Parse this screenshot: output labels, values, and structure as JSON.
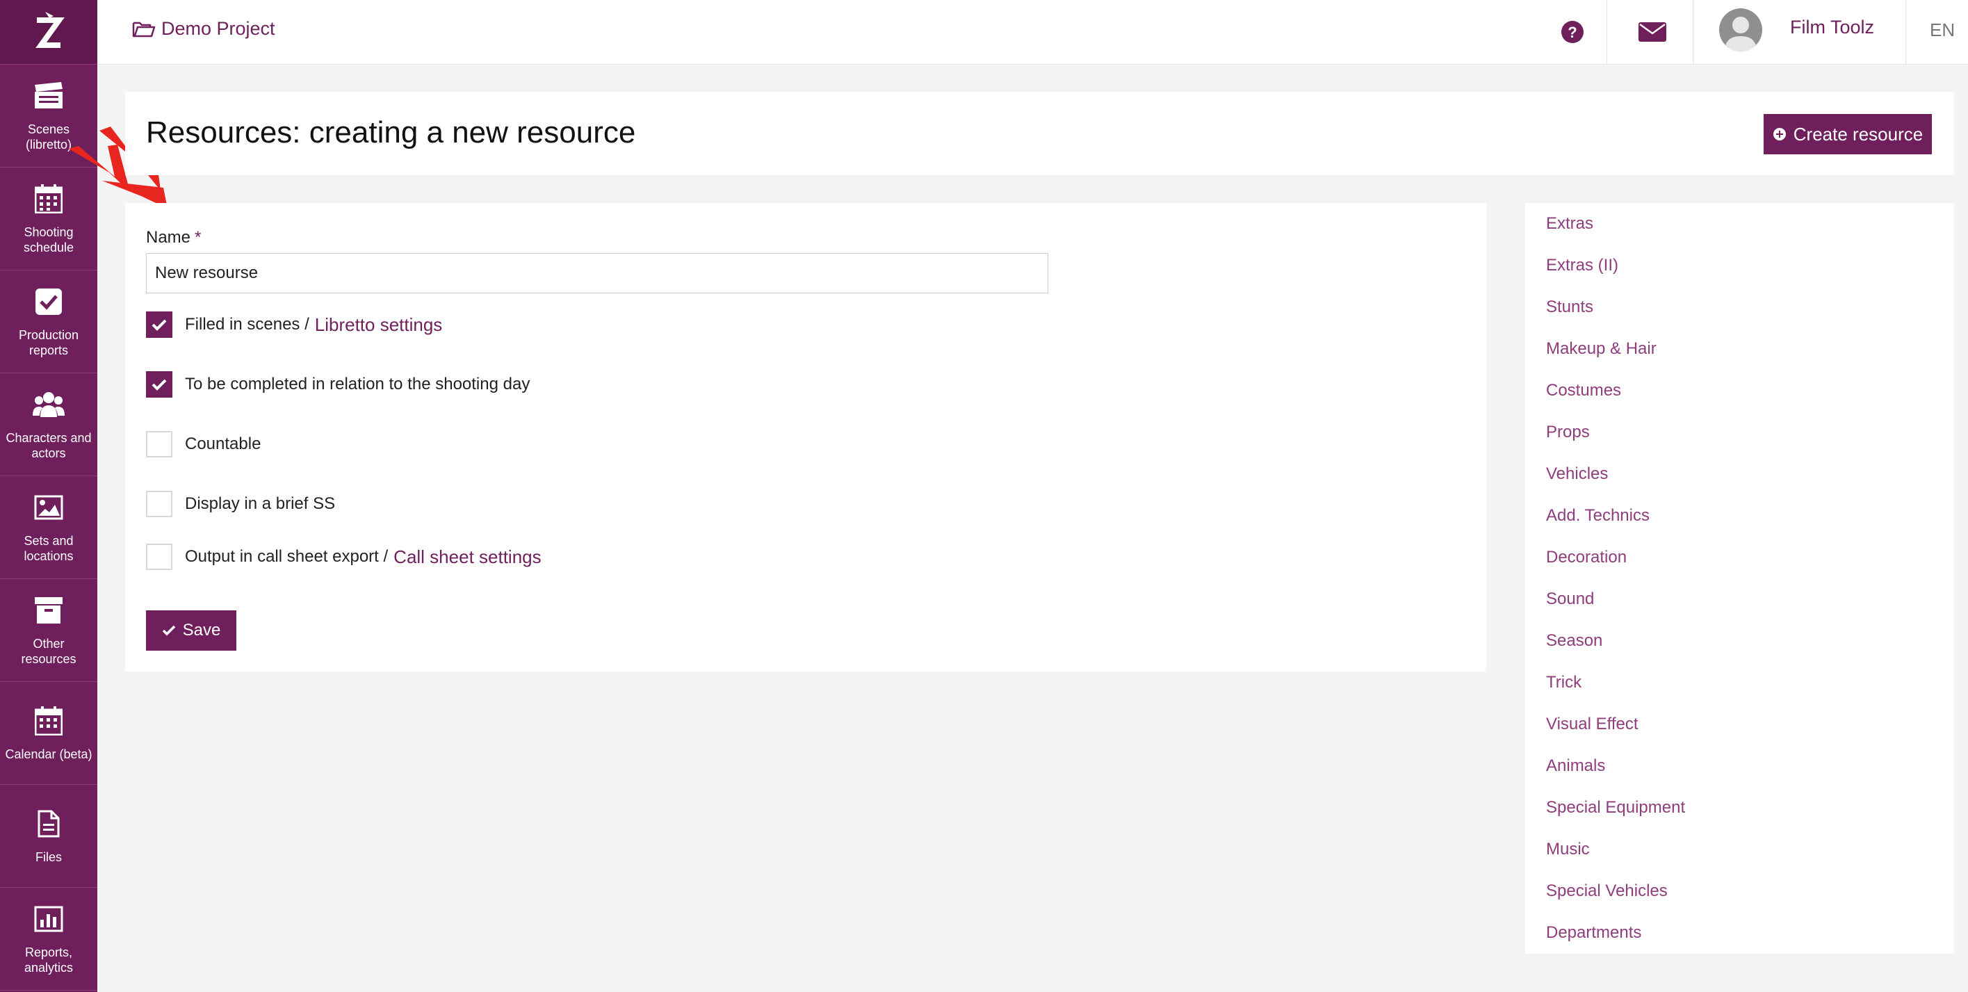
{
  "sidebar": {
    "logo": "Z",
    "items": [
      {
        "label": "Scenes (libretto)",
        "icon": "clapperboard-icon"
      },
      {
        "label": "Shooting schedule",
        "icon": "calendar-grid-icon"
      },
      {
        "label": "Production reports",
        "icon": "check-square-icon"
      },
      {
        "label": "Characters and actors",
        "icon": "users-icon"
      },
      {
        "label": "Sets and locations",
        "icon": "image-icon"
      },
      {
        "label": "Other resources",
        "icon": "archive-box-icon"
      },
      {
        "label": "Calendar (beta)",
        "icon": "calendar-icon"
      },
      {
        "label": "Files",
        "icon": "file-icon"
      },
      {
        "label": "Reports, analytics",
        "icon": "bar-chart-icon"
      }
    ]
  },
  "topbar": {
    "project": "Demo Project",
    "user": "Film Toolz",
    "language": "EN"
  },
  "header": {
    "title": "Resources: creating a new resource",
    "create_button": "Create resource"
  },
  "form": {
    "name_label": "Name",
    "required_mark": "*",
    "name_value": "New resourse",
    "checkboxes": [
      {
        "label": "Filled in scenes /",
        "link": "Libretto settings",
        "checked": true
      },
      {
        "label": "To be completed in relation to the shooting day",
        "checked": true
      },
      {
        "label": "Countable",
        "checked": false
      },
      {
        "label": "Display in a brief SS",
        "checked": false
      },
      {
        "label": "Output in call sheet export /",
        "link": "Call sheet settings",
        "checked": false
      }
    ],
    "save_button": "Save"
  },
  "resources": [
    "Extras",
    "Extras (II)",
    "Stunts",
    "Makeup & Hair",
    "Costumes",
    "Props",
    "Vehicles",
    "Add. Technics",
    "Decoration",
    "Sound",
    "Season",
    "Trick",
    "Visual Effect",
    "Animals",
    "Special Equipment",
    "Music",
    "Special Vehicles",
    "Departments"
  ],
  "colors": {
    "brand": "#6e1f5c",
    "link": "#8f3d7d",
    "annotation_arrow": "#e8261f"
  }
}
